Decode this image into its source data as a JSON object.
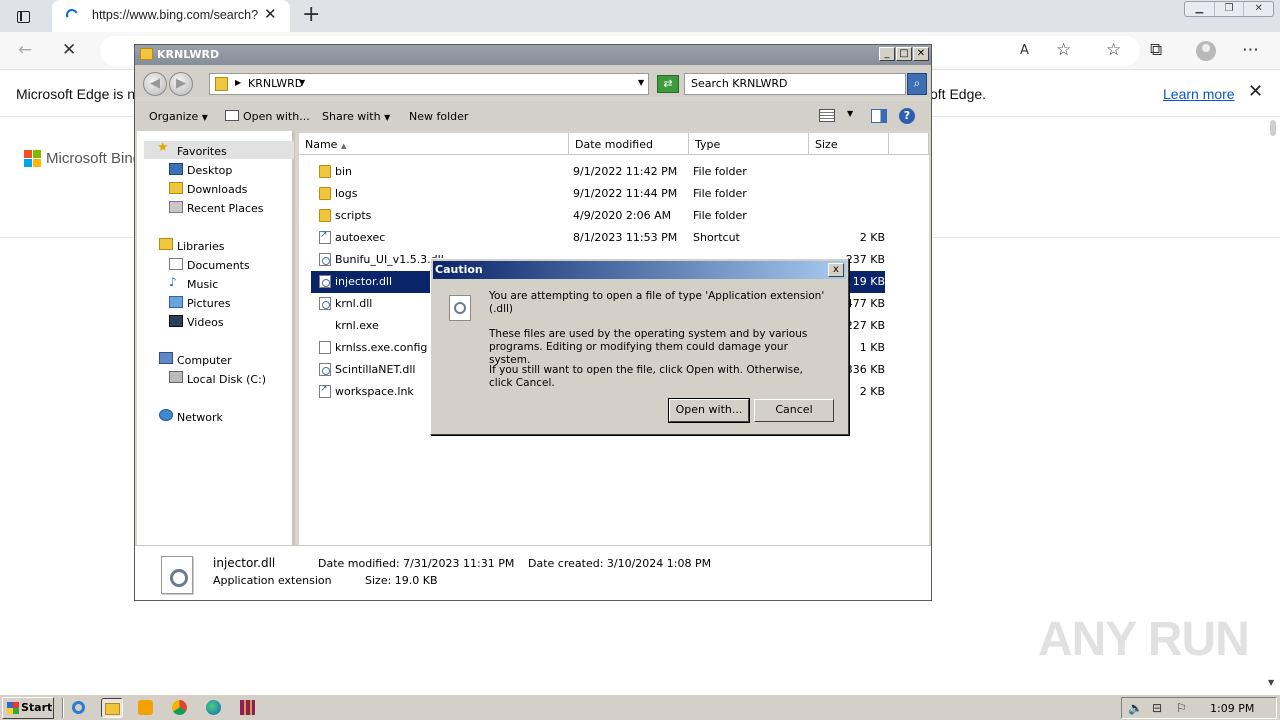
{
  "browser": {
    "tab_title": "https://www.bing.com/search?",
    "new_tab_symbol": "+",
    "infobar_left": "Microsoft Edge is no",
    "infobar_right": "oft Edge.",
    "infobar_link": "Learn more",
    "bing_name": "Microsoft Bing"
  },
  "explorer": {
    "title": "KRNLWRD",
    "address": "KRNLWRD",
    "search_placeholder": "Search KRNLWRD",
    "toolbar": {
      "organize": "Organize",
      "open_with": "Open with...",
      "share_with": "Share with",
      "new_folder": "New folder"
    },
    "nav": {
      "favorites": "Favorites",
      "desktop": "Desktop",
      "downloads": "Downloads",
      "recent_places": "Recent Places",
      "libraries": "Libraries",
      "documents": "Documents",
      "music": "Music",
      "pictures": "Pictures",
      "videos": "Videos",
      "computer": "Computer",
      "local_disk": "Local Disk (C:)",
      "network": "Network"
    },
    "columns": {
      "name": "Name",
      "date": "Date modified",
      "type": "Type",
      "size": "Size"
    },
    "rows": [
      {
        "name": "bin",
        "date": "9/1/2022 11:42 PM",
        "type": "File folder",
        "size": "",
        "icon": "folder-icon"
      },
      {
        "name": "logs",
        "date": "9/1/2022 11:44 PM",
        "type": "File folder",
        "size": "",
        "icon": "folder-icon"
      },
      {
        "name": "scripts",
        "date": "4/9/2020 2:06 AM",
        "type": "File folder",
        "size": "",
        "icon": "folder-icon"
      },
      {
        "name": "autoexec",
        "date": "8/1/2023 11:53 PM",
        "type": "Shortcut",
        "size": "2 KB",
        "icon": "shortcut-icon"
      },
      {
        "name": "Bunifu_UI_v1.5.3.dll",
        "date": "",
        "type": "",
        "size": "237 KB",
        "icon": "dll-icon"
      },
      {
        "name": "injector.dll",
        "date": "",
        "type": "",
        "size": "19 KB",
        "icon": "dll-icon"
      },
      {
        "name": "krnl.dll",
        "date": "",
        "type": "",
        "size": "477 KB",
        "icon": "dll-icon"
      },
      {
        "name": "krnl.exe",
        "date": "",
        "type": "",
        "size": "227 KB",
        "icon": "exe-icon"
      },
      {
        "name": "krnlss.exe.config",
        "date": "",
        "type": "",
        "size": "1 KB",
        "icon": "file-icon"
      },
      {
        "name": "ScintillaNET.dll",
        "date": "",
        "type": "",
        "size": "336 KB",
        "icon": "dll-icon"
      },
      {
        "name": "workspace.lnk",
        "date": "",
        "type": "",
        "size": "2 KB",
        "icon": "shortcut-icon"
      }
    ],
    "selected_index": 5,
    "details": {
      "name": "injector.dll",
      "type": "Application extension",
      "modified": "Date modified: 7/31/2023 11:31 PM",
      "created": "Date created: 3/10/2024 1:08 PM",
      "size": "Size: 19.0 KB"
    }
  },
  "dialog": {
    "title": "Caution",
    "close": "x",
    "line1": "You are attempting to open a file of type 'Application extension' (.dll)",
    "line2": "These files are used by the operating system and by various programs. Editing or modifying them could damage your system.",
    "line3": "If you still want to open the file, click Open with. Otherwise, click Cancel.",
    "open_with": "Open with...",
    "cancel": "Cancel"
  },
  "taskbar": {
    "start": "Start",
    "clock": "1:09 PM"
  },
  "watermark": "ANY RUN"
}
